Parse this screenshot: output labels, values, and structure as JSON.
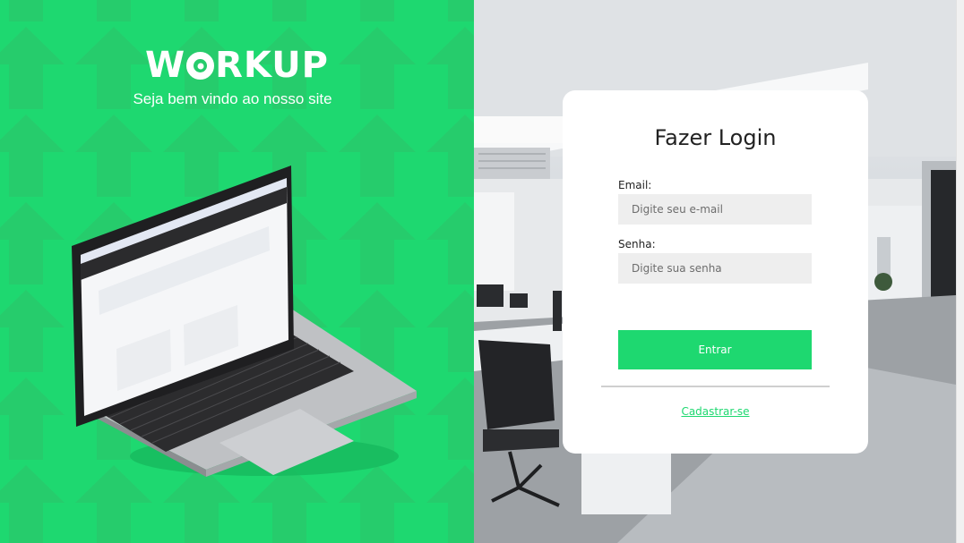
{
  "brand": {
    "name_part1": "W",
    "name_part2": "RKUP",
    "tagline": "Seja bem vindo ao nosso site"
  },
  "login": {
    "title": "Fazer Login",
    "email_label": "Email:",
    "email_placeholder": "Digite seu e-mail",
    "password_label": "Senha:",
    "password_placeholder": "Digite sua senha",
    "submit_label": "Entrar",
    "register_link": "Cadastrar-se"
  },
  "colors": {
    "accent": "#1ed870",
    "arrow_pattern": "#26cc6c",
    "card_bg": "#ffffff",
    "input_bg": "#eeeeee"
  }
}
